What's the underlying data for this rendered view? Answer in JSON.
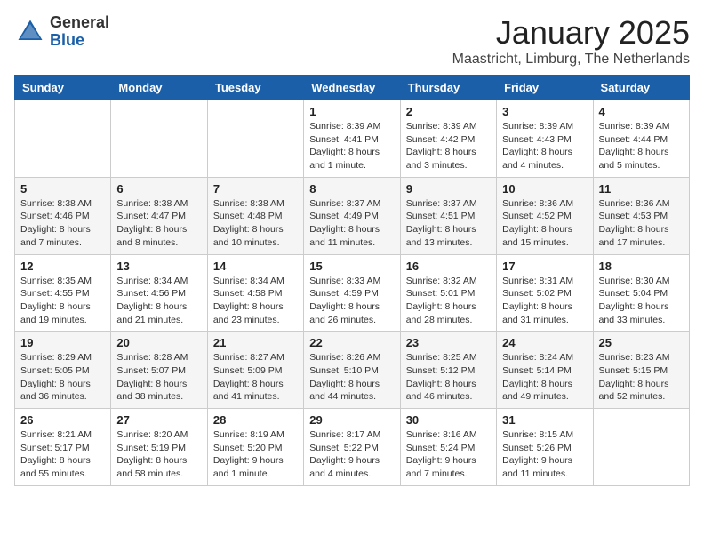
{
  "logo": {
    "general": "General",
    "blue": "Blue"
  },
  "title": "January 2025",
  "location": "Maastricht, Limburg, The Netherlands",
  "days_of_week": [
    "Sunday",
    "Monday",
    "Tuesday",
    "Wednesday",
    "Thursday",
    "Friday",
    "Saturday"
  ],
  "weeks": [
    [
      {
        "day": "",
        "info": ""
      },
      {
        "day": "",
        "info": ""
      },
      {
        "day": "",
        "info": ""
      },
      {
        "day": "1",
        "info": "Sunrise: 8:39 AM\nSunset: 4:41 PM\nDaylight: 8 hours and 1 minute."
      },
      {
        "day": "2",
        "info": "Sunrise: 8:39 AM\nSunset: 4:42 PM\nDaylight: 8 hours and 3 minutes."
      },
      {
        "day": "3",
        "info": "Sunrise: 8:39 AM\nSunset: 4:43 PM\nDaylight: 8 hours and 4 minutes."
      },
      {
        "day": "4",
        "info": "Sunrise: 8:39 AM\nSunset: 4:44 PM\nDaylight: 8 hours and 5 minutes."
      }
    ],
    [
      {
        "day": "5",
        "info": "Sunrise: 8:38 AM\nSunset: 4:46 PM\nDaylight: 8 hours and 7 minutes."
      },
      {
        "day": "6",
        "info": "Sunrise: 8:38 AM\nSunset: 4:47 PM\nDaylight: 8 hours and 8 minutes."
      },
      {
        "day": "7",
        "info": "Sunrise: 8:38 AM\nSunset: 4:48 PM\nDaylight: 8 hours and 10 minutes."
      },
      {
        "day": "8",
        "info": "Sunrise: 8:37 AM\nSunset: 4:49 PM\nDaylight: 8 hours and 11 minutes."
      },
      {
        "day": "9",
        "info": "Sunrise: 8:37 AM\nSunset: 4:51 PM\nDaylight: 8 hours and 13 minutes."
      },
      {
        "day": "10",
        "info": "Sunrise: 8:36 AM\nSunset: 4:52 PM\nDaylight: 8 hours and 15 minutes."
      },
      {
        "day": "11",
        "info": "Sunrise: 8:36 AM\nSunset: 4:53 PM\nDaylight: 8 hours and 17 minutes."
      }
    ],
    [
      {
        "day": "12",
        "info": "Sunrise: 8:35 AM\nSunset: 4:55 PM\nDaylight: 8 hours and 19 minutes."
      },
      {
        "day": "13",
        "info": "Sunrise: 8:34 AM\nSunset: 4:56 PM\nDaylight: 8 hours and 21 minutes."
      },
      {
        "day": "14",
        "info": "Sunrise: 8:34 AM\nSunset: 4:58 PM\nDaylight: 8 hours and 23 minutes."
      },
      {
        "day": "15",
        "info": "Sunrise: 8:33 AM\nSunset: 4:59 PM\nDaylight: 8 hours and 26 minutes."
      },
      {
        "day": "16",
        "info": "Sunrise: 8:32 AM\nSunset: 5:01 PM\nDaylight: 8 hours and 28 minutes."
      },
      {
        "day": "17",
        "info": "Sunrise: 8:31 AM\nSunset: 5:02 PM\nDaylight: 8 hours and 31 minutes."
      },
      {
        "day": "18",
        "info": "Sunrise: 8:30 AM\nSunset: 5:04 PM\nDaylight: 8 hours and 33 minutes."
      }
    ],
    [
      {
        "day": "19",
        "info": "Sunrise: 8:29 AM\nSunset: 5:05 PM\nDaylight: 8 hours and 36 minutes."
      },
      {
        "day": "20",
        "info": "Sunrise: 8:28 AM\nSunset: 5:07 PM\nDaylight: 8 hours and 38 minutes."
      },
      {
        "day": "21",
        "info": "Sunrise: 8:27 AM\nSunset: 5:09 PM\nDaylight: 8 hours and 41 minutes."
      },
      {
        "day": "22",
        "info": "Sunrise: 8:26 AM\nSunset: 5:10 PM\nDaylight: 8 hours and 44 minutes."
      },
      {
        "day": "23",
        "info": "Sunrise: 8:25 AM\nSunset: 5:12 PM\nDaylight: 8 hours and 46 minutes."
      },
      {
        "day": "24",
        "info": "Sunrise: 8:24 AM\nSunset: 5:14 PM\nDaylight: 8 hours and 49 minutes."
      },
      {
        "day": "25",
        "info": "Sunrise: 8:23 AM\nSunset: 5:15 PM\nDaylight: 8 hours and 52 minutes."
      }
    ],
    [
      {
        "day": "26",
        "info": "Sunrise: 8:21 AM\nSunset: 5:17 PM\nDaylight: 8 hours and 55 minutes."
      },
      {
        "day": "27",
        "info": "Sunrise: 8:20 AM\nSunset: 5:19 PM\nDaylight: 8 hours and 58 minutes."
      },
      {
        "day": "28",
        "info": "Sunrise: 8:19 AM\nSunset: 5:20 PM\nDaylight: 9 hours and 1 minute."
      },
      {
        "day": "29",
        "info": "Sunrise: 8:17 AM\nSunset: 5:22 PM\nDaylight: 9 hours and 4 minutes."
      },
      {
        "day": "30",
        "info": "Sunrise: 8:16 AM\nSunset: 5:24 PM\nDaylight: 9 hours and 7 minutes."
      },
      {
        "day": "31",
        "info": "Sunrise: 8:15 AM\nSunset: 5:26 PM\nDaylight: 9 hours and 11 minutes."
      },
      {
        "day": "",
        "info": ""
      }
    ]
  ]
}
